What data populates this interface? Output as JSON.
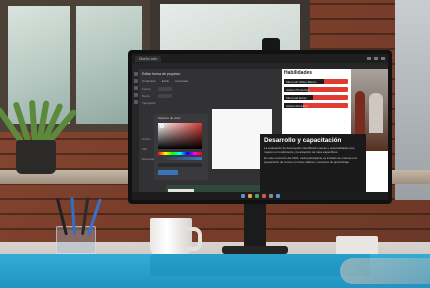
{
  "monitor": {
    "editor": {
      "tab_label": "Diseño web",
      "panel_title": "Editar forma de proyecto",
      "panel_tabs": [
        "Contenido",
        "Estilo",
        "Avanzado"
      ],
      "rows": [
        "Fondo",
        "Borde",
        "Tipografía",
        "Ancho",
        "Alto",
        "Espaciado"
      ],
      "color_picker_title": "Selector de color"
    },
    "slide": {
      "title": "Habilidades",
      "skills": [
        {
          "label": "Microsoft Office Básico",
          "level": 0.62
        },
        {
          "label": "Adobe Photoshop",
          "level": 0.38
        },
        {
          "label": "Microsoft Excel",
          "level": 0.45
        },
        {
          "label": "Adobe Illustrator",
          "level": 0.3
        }
      ]
    },
    "card": {
      "heading": "Desarrollo y capacitación",
      "paragraph_1": "La evaluación de desempeño identificará nuevas y especialidades que mejoren el rendimiento y la adopción de roles específicos.",
      "paragraph_2": "En este momento del 2021, cada participante es invitado de manera a la preparación de cursos en línea, talleres y sesiones de aprendizaje."
    }
  },
  "colors": {
    "accent_red": "#e23b31",
    "band_blue": "#25a9d6",
    "editor_bg": "#323234",
    "card_bg": "#1a1a1a"
  }
}
